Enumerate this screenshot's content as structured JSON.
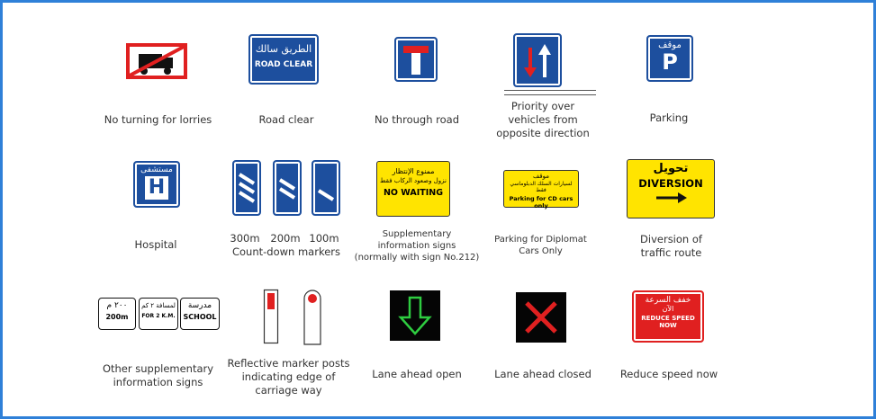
{
  "signs": {
    "no_turning_lorries": {
      "caption": "No turning for lorries"
    },
    "road_clear": {
      "caption": "Road clear",
      "arabic": "الطريق سالك",
      "english": "ROAD CLEAR"
    },
    "no_through_road": {
      "caption": "No through road"
    },
    "priority_over": {
      "caption": "Priority over\nvehicles from\nopposite direction"
    },
    "parking": {
      "caption": "Parking",
      "arabic": "موقف",
      "letter": "P"
    },
    "hospital": {
      "caption": "Hospital",
      "arabic": "مستشفى",
      "letter": "H"
    },
    "countdown": {
      "caption": "Count-down markers",
      "labels": [
        "300m",
        "200m",
        "100m"
      ]
    },
    "supplementary": {
      "caption": "Supplementary\ninformation signs\n(normally with sign No.212)",
      "arabic_1": "ممنوع الإنتظار",
      "arabic_2": "نزول وصعود الركاب فقط",
      "english": "NO WAITING"
    },
    "parking_cd": {
      "caption": "Parking for Diplomat\nCars Only",
      "arabic_1": "موقف",
      "arabic_2": "لسيارات السلك الدبلوماسي فقط",
      "english": "Parking for CD cars only"
    },
    "diversion": {
      "caption": "Diversion of\ntraffic route",
      "arabic": "تحويل",
      "english": "DIVERSION"
    },
    "other_supp": {
      "caption": "Other supplementary\ninformation signs",
      "plate1_ar": "٢٠٠ م",
      "plate1_en": "200m",
      "plate2_ar": "لمسافة ٢ كم",
      "plate2_en": "FOR 2 K.M.",
      "plate3_ar": "مدرسة",
      "plate3_en": "SCHOOL"
    },
    "reflective": {
      "caption": "Reflective marker posts\nindicating edge of\ncarriage way"
    },
    "lane_open": {
      "caption": "Lane ahead open"
    },
    "lane_closed": {
      "caption": "Lane ahead closed"
    },
    "reduce_speed": {
      "caption": "Reduce speed now",
      "arabic_1": "خفف السرعة",
      "arabic_2": "الآن",
      "english_1": "REDUCE SPEED",
      "english_2": "NOW"
    }
  },
  "colors": {
    "frame": "#2f80d8",
    "blue": "#1d4f9e",
    "yellow": "#ffe400",
    "red": "#e02020",
    "green": "#2ecc40"
  }
}
